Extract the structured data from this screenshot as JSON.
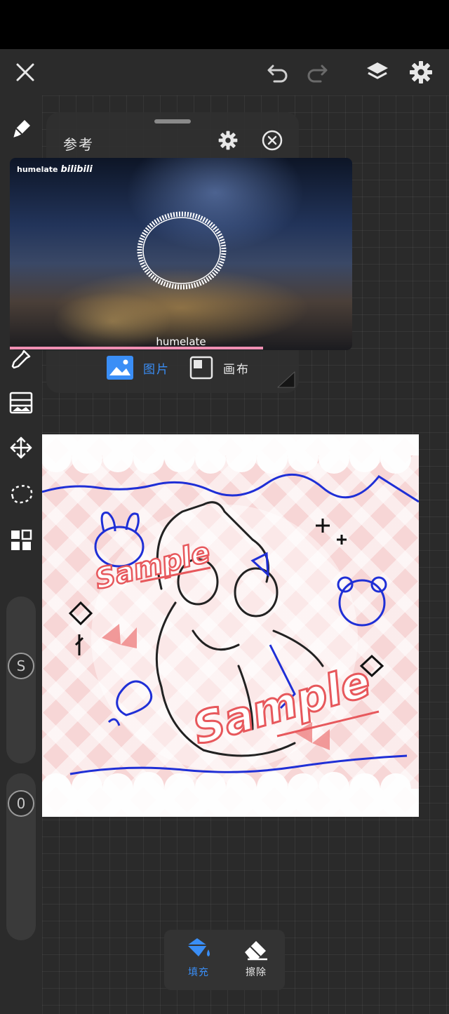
{
  "reference_panel": {
    "title": "参考",
    "watermark_name": "humelate",
    "watermark_brand": "bilibili",
    "caption": "humelate",
    "playback_progress": 0.74,
    "tabs": [
      {
        "label": "图片",
        "active": true
      },
      {
        "label": "画布",
        "active": false
      }
    ]
  },
  "artwork": {
    "watermark_text": [
      "Sample",
      "Sample"
    ]
  },
  "left_toolbar": {
    "size_slider_label": "S",
    "opacity_slider_label": "0"
  },
  "bottom_tools": {
    "fill_label": "填充",
    "erase_label": "擦除"
  },
  "icons": {
    "close": "close-icon",
    "undo": "undo-icon",
    "redo": "redo-icon",
    "layers": "layers-icon",
    "settings": "gear-icon",
    "pen": "pen-icon",
    "eyedropper": "eyedropper-icon",
    "adjust": "image-adjust-icon",
    "move": "move-icon",
    "lasso": "lasso-icon",
    "grid": "grid-icon",
    "fill": "paint-bucket-icon",
    "eraser": "eraser-icon"
  },
  "colors": {
    "accent": "#3a8ef6",
    "toolbar_bg": "#2b2b2b",
    "progress": "#ef8fb3",
    "ink_blue": "#1f2fd6",
    "watermark_red": "#e7585c"
  }
}
